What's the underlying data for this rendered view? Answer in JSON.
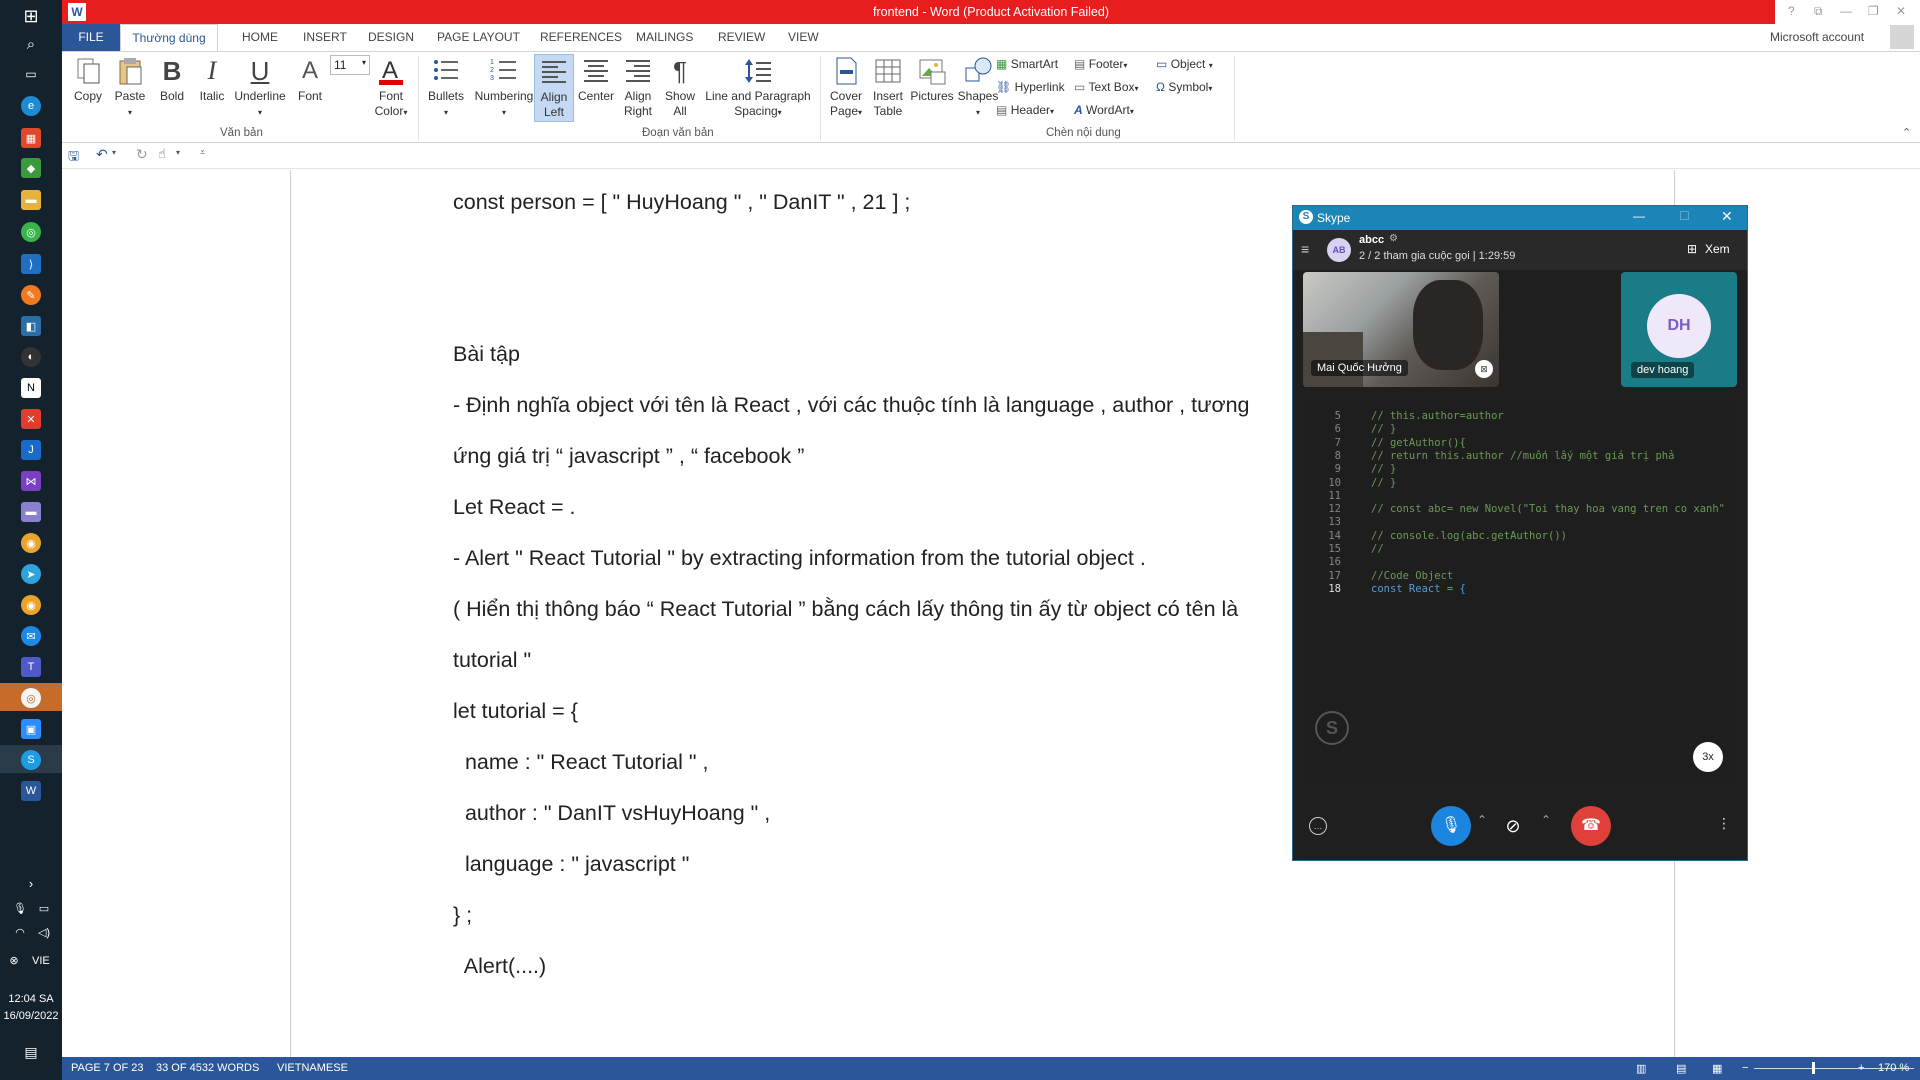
{
  "app": {
    "title": "frontend - Word (Product Activation Failed)",
    "account": "Microsoft account"
  },
  "tabs": {
    "file": "FILE",
    "home": "Thường dùng",
    "others": [
      "HOME",
      "INSERT",
      "DESIGN",
      "PAGE LAYOUT",
      "REFERENCES",
      "MAILINGS",
      "REVIEW",
      "VIEW"
    ]
  },
  "ribbon": {
    "copy": "Copy",
    "paste": "Paste",
    "bold": "Bold",
    "italic": "Italic",
    "underline": "Underline",
    "font": "Font",
    "font_size": "11",
    "font_color_1": "Font",
    "font_color_2": "Color",
    "group_text": "Văn bản",
    "bullets": "Bullets",
    "numbering": "Numbering",
    "align_left_1": "Align",
    "align_left_2": "Left",
    "center": "Center",
    "align_right_1": "Align",
    "align_right_2": "Right",
    "show_all_1": "Show",
    "show_all_2": "All",
    "spacing_1": "Line and Paragraph",
    "spacing_2": "Spacing",
    "group_para": "Đoạn văn bản",
    "cover_1": "Cover",
    "cover_2": "Page",
    "table_1": "Insert",
    "table_2": "Table",
    "pictures": "Pictures",
    "shapes": "Shapes",
    "smartart": "SmartArt",
    "hyperlink": "Hyperlink",
    "header": "Header",
    "footer": "Footer",
    "textbox": "Text Box",
    "wordart": "WordArt",
    "object": "Object",
    "symbol": "Symbol",
    "group_insert": "Chèn nội dung"
  },
  "document": {
    "lines": [
      "const person = [ \" HuyHoang \" , \" DanIT \" , 21 ] ;",
      "Bài tập",
      "- Định nghĩa object với tên là React , với các thuộc tính là language , author , tương",
      "ứng giá trị “ javascript ” , “ facebook ”",
      "Let React = .",
      "- Alert \" React Tutorial \" by extracting information from the tutorial object .",
      "( Hiển thị thông báo “ React Tutorial ” bằng cách lấy thông tin ấy từ object có tên là",
      "tutorial \"",
      "let tutorial = {",
      "  name : \" React Tutorial \" ,",
      "  author : \" DanIT vsHuyHoang \" ,",
      "  language : \" javascript \"",
      "} ;",
      "  Alert(....)"
    ]
  },
  "status": {
    "page": "PAGE 7 OF 23",
    "words": "33 OF 4532 WORDS",
    "language": "VIETNAMESE",
    "zoom": "170 %"
  },
  "taskbar": {
    "time": "12:04 SA",
    "date": "16/09/2022",
    "lang": "VIE"
  },
  "skype": {
    "title": "Skype",
    "chat_name": "abcc",
    "avatar": "AB",
    "participants": "2 / 2 tham gia cuộc gọi | 1:29:59",
    "view": "Xem",
    "caller1": "Mai Quốc Hưởng",
    "caller2": "dev hoang",
    "caller2_initials": "DH",
    "speed": "3x",
    "code": [
      {
        "n": "5",
        "t": "//         this.author=author"
      },
      {
        "n": "6",
        "t": "//     }"
      },
      {
        "n": "7",
        "t": "//     getAuthor(){"
      },
      {
        "n": "8",
        "t": "//         return this.author //muốn lấy một giá trị phả"
      },
      {
        "n": "9",
        "t": "//     }"
      },
      {
        "n": "10",
        "t": "// }"
      },
      {
        "n": "11",
        "t": ""
      },
      {
        "n": "12",
        "t": "// const abc= new Novel(\"Toi thay hoa vang tren co xanh\""
      },
      {
        "n": "13",
        "t": ""
      },
      {
        "n": "14",
        "t": "// console.log(abc.getAuthor())"
      },
      {
        "n": "15",
        "t": "//"
      },
      {
        "n": "16",
        "t": ""
      },
      {
        "n": "17",
        "t": "//Code Object"
      },
      {
        "n": "18",
        "t": "const React = {"
      }
    ]
  },
  "colors": {
    "word_blue": "#2b579a",
    "title_red": "#e81e1e",
    "skype_blue": "#1b85b8",
    "end_call": "#e0403a"
  }
}
